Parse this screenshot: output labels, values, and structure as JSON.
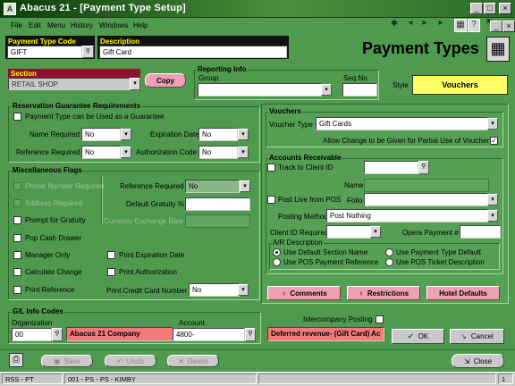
{
  "window": {
    "title": "Abacus 21 - [Payment Type Setup]",
    "app_icon": "A"
  },
  "menu": [
    "File",
    "Edit",
    "Menu",
    "History",
    "Windows",
    "Help"
  ],
  "header": {
    "payment_type_code_label": "Payment Type Code",
    "payment_type_code": "GIFT",
    "description_label": "Description",
    "description": "Gift Card",
    "page_title": "Payment Types"
  },
  "section": {
    "label": "Section",
    "value": "RETAIL SHOP",
    "copy_label": "Copy"
  },
  "reporting": {
    "label": "Reporting Info",
    "group_label": "Group",
    "group_value": "",
    "seq_label": "Seq No.",
    "seq_value": "",
    "style_label": "Style",
    "style_value": "Vouchers"
  },
  "guarantee": {
    "title": "Reservation Guarantee Requirements",
    "can_be_guarantee_label": "Payment Type can be Used as a Guarantee",
    "name_required_label": "Name Required",
    "name_required": "No",
    "reference_required_label": "Reference Required",
    "reference_required": "No",
    "expiration_date_label": "Expiration Date",
    "expiration_date": "No",
    "authorization_code_label": "Authorization Code",
    "authorization_code": "No"
  },
  "misc": {
    "title": "Miscellaneous Flags",
    "phone_required": "Phone Number Required",
    "address_required": "Address Required",
    "prompt_gratuity": "Prompt for Gratuity",
    "pop_cash_drawer": "Pop Cash Drawer",
    "manager_only": "Manager Only",
    "calculate_change": "Calculate Change",
    "print_reference": "Print Reference",
    "reference_required_label": "Reference Required",
    "reference_required": "No",
    "default_gratuity_label": "Default Gratuity %",
    "default_gratuity": "",
    "currency_rate_label": "Currency Exchange Rate",
    "currency_rate": "",
    "print_expiration": "Print Expiration Date",
    "print_authorization": "Print Authorization",
    "print_cc_label": "Print Credit Card Number",
    "print_cc": "No"
  },
  "vouchers": {
    "title": "Vouchers",
    "voucher_type_label": "Voucher Type",
    "voucher_type": "Gift Cards",
    "allow_change_label": "Allow Change to be Given for Partial Use of Voucher",
    "allow_change_checked": true
  },
  "ar": {
    "title": "Accounts Receivable",
    "track_client_label": "Track to Client ID",
    "track_client_value": "",
    "name_label": "Name",
    "name_value": "",
    "post_live_label": "Post Live from POS",
    "folio_label": "Folio",
    "folio_value": "",
    "posting_method_label": "Posting Method",
    "posting_method": "Post Nothing",
    "client_id_required_label": "Client ID Required",
    "client_id_required": "",
    "opera_payment_label": "Opera Payment #",
    "opera_payment": "",
    "ar_description_title": "A/R Description",
    "radio_default_section": "Use Default Section Name",
    "radio_pos_reference": "Use POS Payment Reference",
    "radio_payment_type_default": "Use Payment Type Default",
    "radio_pos_ticket": "Use POS Ticket Description"
  },
  "actions": {
    "comments": "Comments",
    "restrictions": "Restrictions",
    "hotel_defaults": "Hotel Defaults",
    "ok": "OK",
    "cancel": "Cancel"
  },
  "gl": {
    "title": "G/L Info Codes",
    "organization_label": "Organization",
    "organization": "00",
    "organization_name": "Abacus 21 Company",
    "account_label": "Account",
    "account": "4800-",
    "account_name": "Deferred revenue- (Gift Card) Ac",
    "intercompany_label": "Intercompany Posting"
  },
  "footer": {
    "save": "Save",
    "undo": "Undo",
    "delete": "Delete",
    "close": "Close"
  },
  "status": {
    "left": "RSS - PT",
    "middle": "001 - PS - PS - KIMBY",
    "right": "1"
  },
  "colors": {
    "background": "#4f9a4f",
    "pink_button": "#f0a0b4",
    "highlight": "#f47a7a",
    "style_yellow": "#ffff66"
  }
}
